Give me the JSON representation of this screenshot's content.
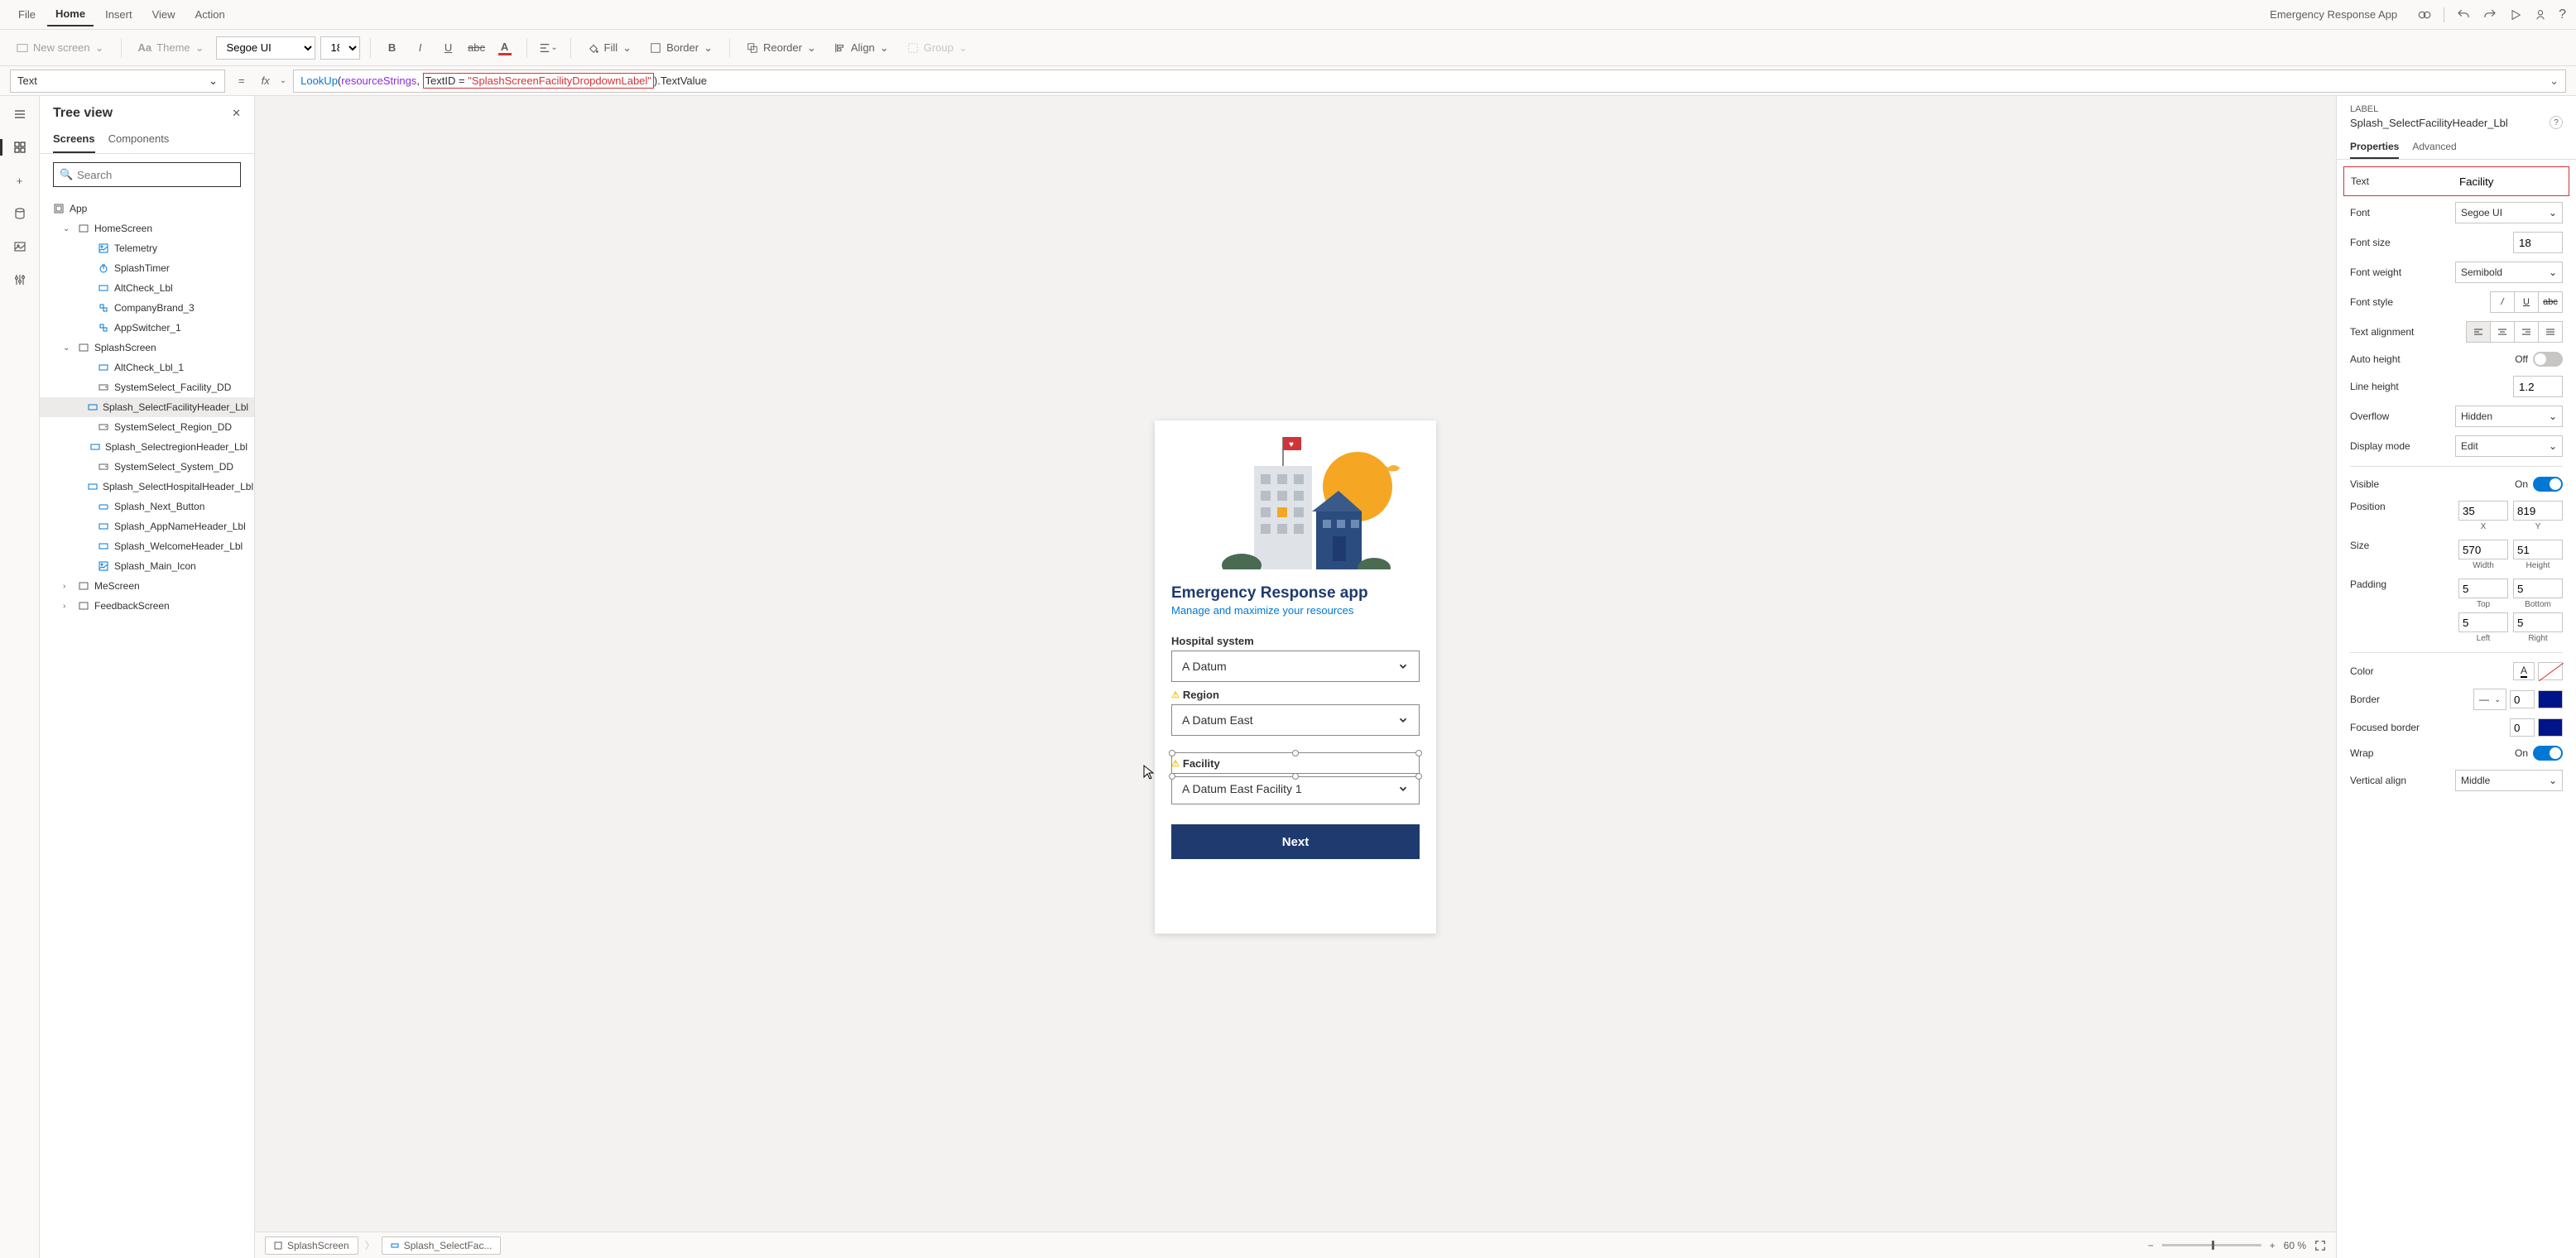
{
  "topMenu": {
    "items": [
      "File",
      "Home",
      "Insert",
      "View",
      "Action"
    ],
    "activeIndex": 1,
    "appName": "Emergency Response App"
  },
  "ribbon": {
    "newScreen": "New screen",
    "theme": "Theme",
    "font": "Segoe UI",
    "fontSize": "18",
    "fill": "Fill",
    "border": "Border",
    "reorder": "Reorder",
    "align": "Align",
    "group": "Group"
  },
  "formulaBar": {
    "property": "Text",
    "fn": "LookUp",
    "var": "resourceStrings",
    "highlightedText": "TextID = \"SplashScreenFacilityDropdownLabel\"",
    "suffix": ".TextValue"
  },
  "treeView": {
    "title": "Tree view",
    "tabs": [
      "Screens",
      "Components"
    ],
    "searchPlaceholder": "Search",
    "app": "App",
    "items": [
      {
        "label": "HomeScreen",
        "level": 1,
        "expandable": true,
        "expanded": true,
        "icon": "screen"
      },
      {
        "label": "Telemetry",
        "level": 2,
        "icon": "img"
      },
      {
        "label": "SplashTimer",
        "level": 2,
        "icon": "timer"
      },
      {
        "label": "AltCheck_Lbl",
        "level": 2,
        "icon": "label"
      },
      {
        "label": "CompanyBrand_3",
        "level": 2,
        "icon": "component"
      },
      {
        "label": "AppSwitcher_1",
        "level": 2,
        "icon": "component"
      },
      {
        "label": "SplashScreen",
        "level": 1,
        "expandable": true,
        "expanded": true,
        "icon": "screen"
      },
      {
        "label": "AltCheck_Lbl_1",
        "level": 2,
        "icon": "label"
      },
      {
        "label": "SystemSelect_Facility_DD",
        "level": 2,
        "icon": "dd"
      },
      {
        "label": "Splash_SelectFacilityHeader_Lbl",
        "level": 2,
        "icon": "label",
        "selected": true
      },
      {
        "label": "SystemSelect_Region_DD",
        "level": 2,
        "icon": "dd"
      },
      {
        "label": "Splash_SelectregionHeader_Lbl",
        "level": 2,
        "icon": "label"
      },
      {
        "label": "SystemSelect_System_DD",
        "level": 2,
        "icon": "dd"
      },
      {
        "label": "Splash_SelectHospitalHeader_Lbl",
        "level": 2,
        "icon": "label"
      },
      {
        "label": "Splash_Next_Button",
        "level": 2,
        "icon": "btn"
      },
      {
        "label": "Splash_AppNameHeader_Lbl",
        "level": 2,
        "icon": "label"
      },
      {
        "label": "Splash_WelcomeHeader_Lbl",
        "level": 2,
        "icon": "label"
      },
      {
        "label": "Splash_Main_Icon",
        "level": 2,
        "icon": "img"
      },
      {
        "label": "MeScreen",
        "level": 1,
        "expandable": true,
        "expanded": false,
        "icon": "screen"
      },
      {
        "label": "FeedbackScreen",
        "level": 1,
        "expandable": true,
        "expanded": false,
        "icon": "screen"
      }
    ]
  },
  "canvas": {
    "appTitle": "Emergency Response app",
    "appSubtitle": "Manage and maximize your resources",
    "labels": {
      "hospital": "Hospital system",
      "region": "Region",
      "facility": "Facility"
    },
    "values": {
      "hospital": "A Datum",
      "region": "A Datum East",
      "facility": "A Datum East Facility 1"
    },
    "nextButton": "Next",
    "breadcrumb1": "SplashScreen",
    "breadcrumb2": "Splash_SelectFac...",
    "zoom": "60 %"
  },
  "properties": {
    "type": "LABEL",
    "name": "Splash_SelectFacilityHeader_Lbl",
    "tabs": [
      "Properties",
      "Advanced"
    ],
    "rows": {
      "text": {
        "label": "Text",
        "value": "Facility"
      },
      "font": {
        "label": "Font",
        "value": "Segoe UI"
      },
      "fontSize": {
        "label": "Font size",
        "value": "18"
      },
      "fontWeight": {
        "label": "Font weight",
        "value": "Semibold"
      },
      "fontStyle": {
        "label": "Font style"
      },
      "textAlign": {
        "label": "Text alignment"
      },
      "autoHeight": {
        "label": "Auto height",
        "value": "Off"
      },
      "lineHeight": {
        "label": "Line height",
        "value": "1.2"
      },
      "overflow": {
        "label": "Overflow",
        "value": "Hidden"
      },
      "displayMode": {
        "label": "Display mode",
        "value": "Edit"
      },
      "visible": {
        "label": "Visible",
        "value": "On"
      },
      "position": {
        "label": "Position",
        "x": "35",
        "y": "819",
        "xl": "X",
        "yl": "Y"
      },
      "size": {
        "label": "Size",
        "w": "570",
        "h": "51",
        "wl": "Width",
        "hl": "Height"
      },
      "padding": {
        "label": "Padding",
        "t": "5",
        "b": "5",
        "l": "5",
        "r": "5",
        "tl": "Top",
        "bl": "Bottom",
        "ll": "Left",
        "rl": "Right"
      },
      "color": {
        "label": "Color"
      },
      "border": {
        "label": "Border",
        "value": "0"
      },
      "focusedBorder": {
        "label": "Focused border",
        "value": "0"
      },
      "wrap": {
        "label": "Wrap",
        "value": "On"
      },
      "verticalAlign": {
        "label": "Vertical align",
        "value": "Middle"
      }
    }
  }
}
